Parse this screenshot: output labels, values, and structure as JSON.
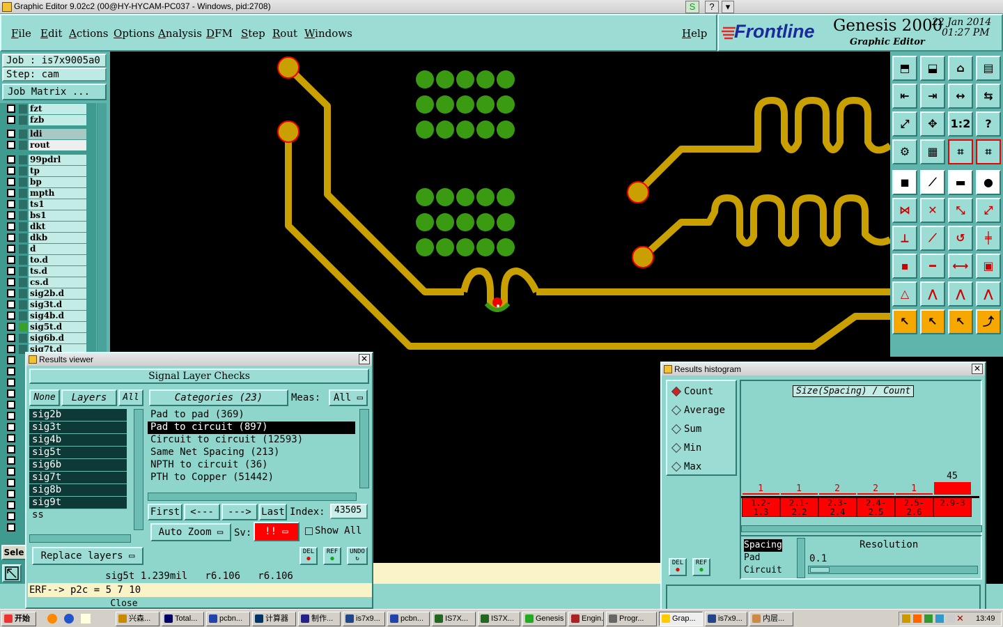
{
  "window": {
    "title": "Graphic Editor 9.02c2 (00@HY-HYCAM-PC037 - Windows, pid:2708)",
    "btn_s": "S",
    "btn_help": "?",
    "btn_menu": "▾"
  },
  "menu": [
    "File",
    "Edit",
    "Actions",
    "Options",
    "Analysis",
    "DFM",
    "Step",
    "Rout",
    "Windows"
  ],
  "help": "Help",
  "brand": {
    "logo": "Frontline",
    "product": "Genesis 2000",
    "subtitle": "Graphic Editor",
    "date": "22 Jan 2014",
    "time": "01:27 PM"
  },
  "job": {
    "job_label": "Job : is7x9005a0",
    "step_label": "Step: cam",
    "matrix_btn": "Job Matrix ..."
  },
  "layers": [
    {
      "name": "fzt",
      "color": "#2d6f67"
    },
    {
      "name": "fzb",
      "color": "#2d6f67"
    },
    {
      "name": "ldi",
      "color": "#2d6f67",
      "active": true
    },
    {
      "name": "rout",
      "color": "#2d6f67",
      "highlight": true
    },
    {
      "name": "99pdrl",
      "color": "#2d6f67"
    },
    {
      "name": "tp",
      "color": "#2d6f67"
    },
    {
      "name": "bp",
      "color": "#2d6f67"
    },
    {
      "name": "mpth",
      "color": "#2d6f67"
    },
    {
      "name": "ts1",
      "color": "#2d6f67"
    },
    {
      "name": "bs1",
      "color": "#2d6f67"
    },
    {
      "name": "dkt",
      "color": "#2d6f67"
    },
    {
      "name": "dkb",
      "color": "#2d6f67"
    },
    {
      "name": "d",
      "color": "#2d6f67"
    },
    {
      "name": "to.d",
      "color": "#2d6f67"
    },
    {
      "name": "ts.d",
      "color": "#2d6f67"
    },
    {
      "name": "cs.d",
      "color": "#2d6f67"
    },
    {
      "name": "sig2b.d",
      "color": "#2d6f67"
    },
    {
      "name": "sig3t.d",
      "color": "#2d6f67"
    },
    {
      "name": "sig4b.d",
      "color": "#2d6f67"
    },
    {
      "name": "sig5t.d",
      "color": "#3aa02a"
    },
    {
      "name": "sig6b.d",
      "color": "#2d6f67"
    },
    {
      "name": "sig7t.d",
      "color": "#2d6f67"
    }
  ],
  "sele": "Sele",
  "results_viewer": {
    "title": "Results viewer",
    "header": "Signal Layer Checks",
    "none_btn": "None",
    "layers_btn": "Layers",
    "all_btn": "All",
    "categories_btn": "Categories (23)",
    "meas_label": "Meas:",
    "meas_value": "All",
    "layer_list": [
      "sig2b",
      "sig3t",
      "sig4b",
      "sig5t",
      "sig6b",
      "sig7t",
      "sig8b",
      "sig9t",
      "ss"
    ],
    "categories": [
      "Pad to pad (369)",
      "Pad to circuit (897)",
      "Circuit to circuit (12593)",
      "Same Net Spacing (213)",
      "NPTH to circuit (36)",
      "PTH to Copper (51442)"
    ],
    "selected_category": 1,
    "first": "First",
    "prev": "<---",
    "next": "--->",
    "last": "Last",
    "index_label": "Index:",
    "index_value": "43505",
    "autozoom": "Auto Zoom",
    "sv_label": "Sv:",
    "sv_value": "!!",
    "show_all": "Show All",
    "replace_layers": "Replace layers",
    "del": "DEL",
    "ref": "REF",
    "undo": "UNDO",
    "status": "sig5t 1.239mil   r6.106   r6.106",
    "erf": "ERF--> p2c = 5 7 10",
    "close": "Close"
  },
  "histogram": {
    "title": "Results histogram",
    "modes": [
      "Count",
      "Average",
      "Sum",
      "Min",
      "Max"
    ],
    "selected_mode": "Count",
    "chart_title": "Size(Spacing) / Count",
    "res_list": [
      "Spacing",
      "Pad",
      "Circuit"
    ],
    "resolution_label": "Resolution",
    "resolution_value": "0.1",
    "del": "DEL",
    "ref": "REF"
  },
  "chart_data": {
    "type": "bar",
    "title": "Size(Spacing) / Count",
    "categories": [
      "1.2-1.3",
      "2.1-2.2",
      "2.3-2.4",
      "2.4-2.5",
      "2.5-2.6",
      "2.9-3"
    ],
    "values": [
      1,
      1,
      2,
      2,
      1,
      45
    ],
    "bar_color": "#ff0000"
  },
  "taskbar": {
    "start": "开始",
    "tasks": [
      "兴森...",
      "Total...",
      "pcbn...",
      "计算器",
      "制作...",
      "is7x9...",
      "pcbn...",
      "IS7X...",
      "IS7X...",
      "Genesis",
      "Engin...",
      "Progr...",
      "Grap...",
      "is7x9...",
      "内层..."
    ],
    "clock": "13:49"
  }
}
